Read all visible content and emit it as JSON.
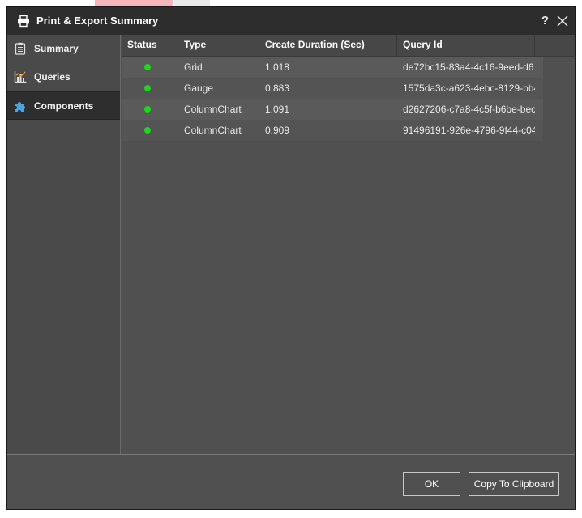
{
  "dialog": {
    "title": "Print & Export Summary",
    "help_label": "?"
  },
  "sidebar": {
    "items": [
      {
        "label": "Summary",
        "icon": "clipboard-icon"
      },
      {
        "label": "Queries",
        "icon": "chart-icon"
      },
      {
        "label": "Components",
        "icon": "puzzle-icon",
        "active": true
      }
    ]
  },
  "table": {
    "columns": [
      "Status",
      "Type",
      "Create Duration (Sec)",
      "Query Id"
    ],
    "rows": [
      {
        "status": "ok",
        "type": "Grid",
        "duration": "1.018",
        "query_id": "de72bc15-83a4-4c16-9eed-d6"
      },
      {
        "status": "ok",
        "type": "Gauge",
        "duration": "0.883",
        "query_id": "1575da3c-a623-4ebc-8129-bb4"
      },
      {
        "status": "ok",
        "type": "ColumnChart",
        "duration": "1.091",
        "query_id": "d2627206-c7a8-4c5f-b6be-bec"
      },
      {
        "status": "ok",
        "type": "ColumnChart",
        "duration": "0.909",
        "query_id": "91496191-926e-4796-9f44-c04"
      }
    ]
  },
  "footer": {
    "ok_label": "OK",
    "copy_label": "Copy To Clipboard"
  },
  "colors": {
    "status_ok": "#19d919",
    "titlebar": "#2d2d2d",
    "panel": "#505050"
  }
}
